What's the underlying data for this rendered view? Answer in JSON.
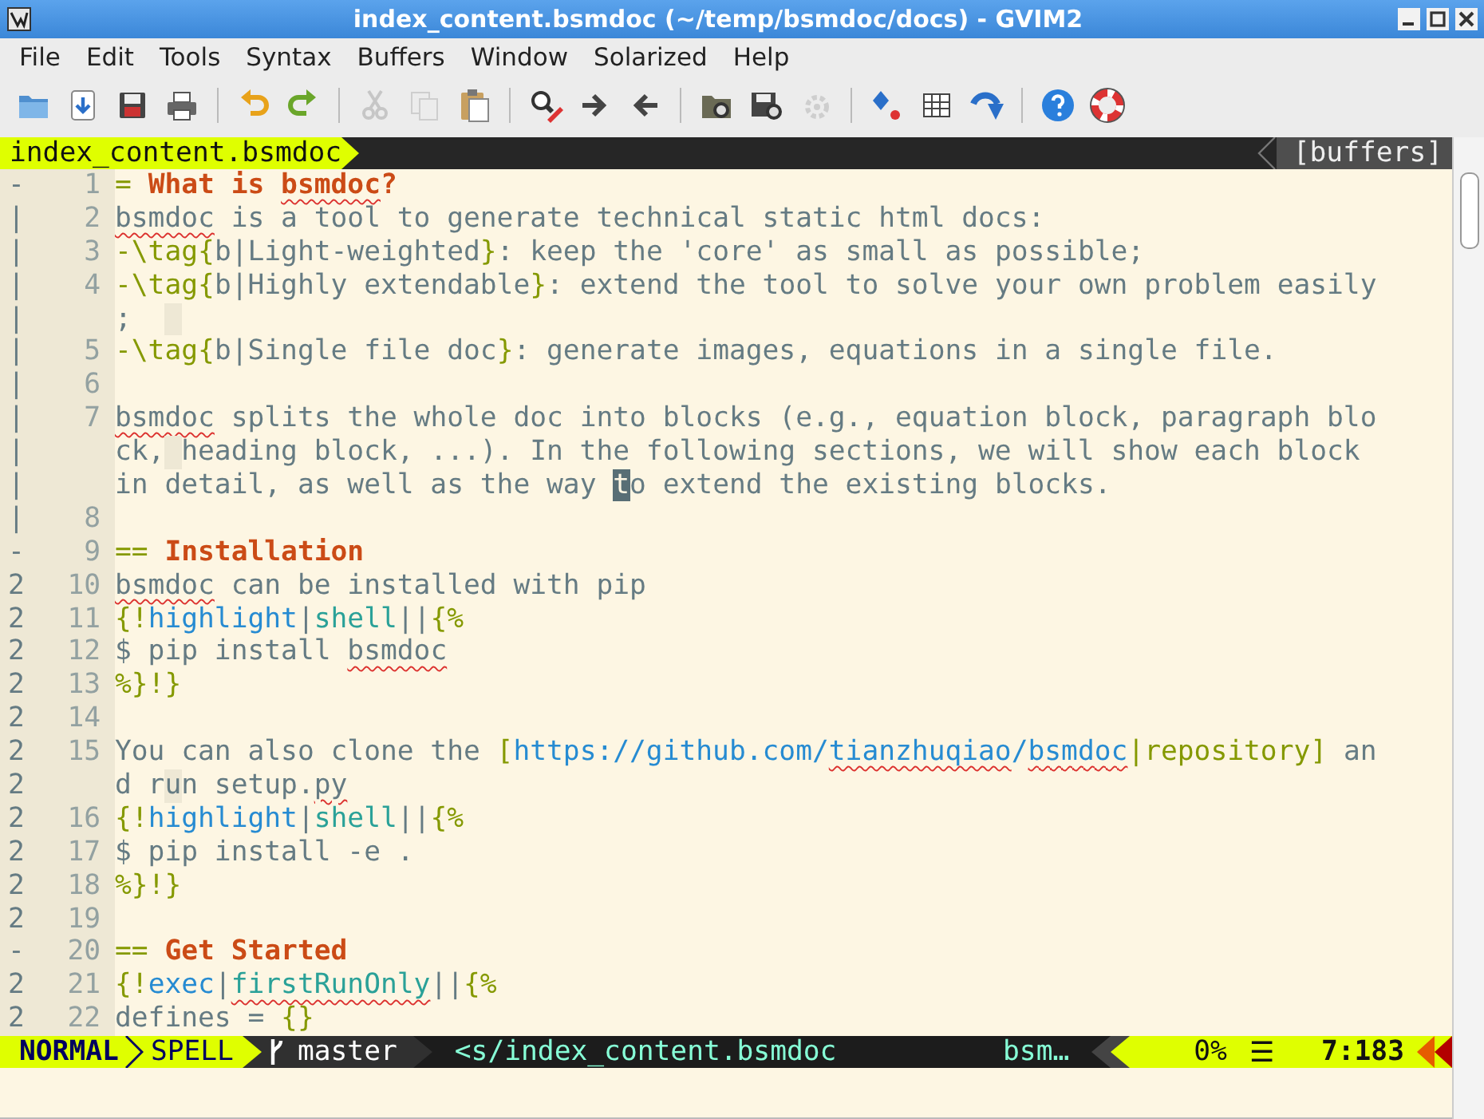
{
  "window": {
    "title": "index_content.bsmdoc (~/temp/bsmdoc/docs) - GVIM2"
  },
  "menu": [
    "File",
    "Edit",
    "Tools",
    "Syntax",
    "Buffers",
    "Window",
    "Solarized",
    "Help"
  ],
  "toolbar": [
    [
      {
        "disabled": false
      },
      {
        "disabled": false
      },
      {
        "disabled": false
      },
      {
        "disabled": false
      }
    ],
    [
      {
        "disabled": false
      },
      {
        "disabled": false
      }
    ],
    [
      {
        "disabled": true
      },
      {
        "disabled": true
      },
      {
        "disabled": false
      }
    ],
    [
      {
        "disabled": false
      },
      {
        "disabled": false
      },
      {
        "disabled": false
      }
    ],
    [
      {
        "disabled": false
      },
      {
        "disabled": false
      },
      {
        "disabled": true
      }
    ],
    [
      {
        "disabled": false
      },
      {
        "disabled": false
      },
      {
        "disabled": false
      }
    ],
    [
      {
        "disabled": false
      },
      {
        "disabled": false
      }
    ]
  ],
  "tabline": {
    "current": "index_content.bsmdoc",
    "right": "[buffers]"
  },
  "rows": [
    {
      "fold": "-",
      "number": "1",
      "segments": [
        {
          "kind": "markup",
          "text": "= ",
          "misspelled": false
        },
        {
          "kind": "heading",
          "text": "What is ",
          "misspelled": false
        },
        {
          "kind": "heading",
          "text": "bsmdoc",
          "misspelled": true
        },
        {
          "kind": "heading",
          "text": "?",
          "misspelled": false
        }
      ]
    },
    {
      "fold": "|",
      "number": "2",
      "segments": [
        {
          "kind": "text",
          "text": "bsmdoc",
          "misspelled": true
        },
        {
          "kind": "text",
          "text": " is a tool to generate technical static html docs:",
          "misspelled": false
        }
      ]
    },
    {
      "fold": "|",
      "number": "3",
      "segments": [
        {
          "kind": "markup",
          "text": "-\\tag{",
          "misspelled": false
        },
        {
          "kind": "text",
          "text": "b|Light-weighted",
          "misspelled": false
        },
        {
          "kind": "markup",
          "text": "}",
          "misspelled": false
        },
        {
          "kind": "text",
          "text": ": keep the 'core' as small as possible;",
          "misspelled": false
        }
      ]
    },
    {
      "fold": "|",
      "number": "4",
      "segments": [
        {
          "kind": "markup",
          "text": "-\\tag{",
          "misspelled": false
        },
        {
          "kind": "text",
          "text": "b|Highly extendable",
          "misspelled": false
        },
        {
          "kind": "markup",
          "text": "}",
          "misspelled": false
        },
        {
          "kind": "text",
          "text": ": extend the tool to solve your own problem easily",
          "misspelled": false
        }
      ]
    },
    {
      "fold": "|",
      "segments": [
        {
          "kind": "text",
          "text": ";",
          "misspelled": false
        },
        {
          "kind": "shade",
          "misspelled": false
        }
      ]
    },
    {
      "fold": "|",
      "number": "5",
      "segments": [
        {
          "kind": "markup",
          "text": "-\\tag{",
          "misspelled": false
        },
        {
          "kind": "text",
          "text": "b|Single file doc",
          "misspelled": false
        },
        {
          "kind": "markup",
          "text": "}",
          "misspelled": false
        },
        {
          "kind": "text",
          "text": ": generate images, equations in a single file.",
          "misspelled": false
        }
      ]
    },
    {
      "fold": "|",
      "number": "6",
      "segments": []
    },
    {
      "fold": "|",
      "number": "7",
      "segments": [
        {
          "kind": "text",
          "text": "bsmdoc",
          "misspelled": true
        },
        {
          "kind": "text",
          "text": " splits the whole doc into blocks (e.g., equation block, paragraph blo",
          "misspelled": false
        }
      ]
    },
    {
      "fold": "|",
      "segments": [
        {
          "kind": "text",
          "text": "ck,",
          "misspelled": false
        },
        {
          "kind": "shade",
          "misspelled": false
        },
        {
          "kind": "text",
          "text": "heading block, ...). In the following sections, we will show each block",
          "misspelled": false
        }
      ]
    },
    {
      "fold": "|",
      "segments": [
        {
          "kind": "text",
          "text": "in detail, as well as the way ",
          "misspelled": false
        },
        {
          "kind": "cursor",
          "text": "t",
          "misspelled": false
        },
        {
          "kind": "text",
          "text": "o extend the existing blocks.",
          "misspelled": false
        }
      ]
    },
    {
      "fold": "|",
      "number": "8",
      "segments": []
    },
    {
      "fold": "-",
      "number": "9",
      "segments": [
        {
          "kind": "markup",
          "text": "== ",
          "misspelled": false
        },
        {
          "kind": "heading",
          "text": "Installation",
          "misspelled": false
        }
      ]
    },
    {
      "fold": "2",
      "number": "10",
      "segments": [
        {
          "kind": "text",
          "text": "bsmdoc",
          "misspelled": true
        },
        {
          "kind": "text",
          "text": " can be installed with pip",
          "misspelled": false
        }
      ]
    },
    {
      "fold": "2",
      "number": "11",
      "segments": [
        {
          "kind": "markup",
          "text": "{!",
          "misspelled": false
        },
        {
          "kind": "keyword",
          "text": "highlight",
          "misspelled": false
        },
        {
          "kind": "text",
          "text": "|",
          "misspelled": false
        },
        {
          "kind": "name",
          "text": "shell",
          "misspelled": false
        },
        {
          "kind": "text",
          "text": "||",
          "misspelled": false
        },
        {
          "kind": "markup",
          "text": "{%",
          "misspelled": false
        }
      ]
    },
    {
      "fold": "2",
      "number": "12",
      "segments": [
        {
          "kind": "text",
          "text": "$ pip install ",
          "misspelled": false
        },
        {
          "kind": "text",
          "text": "bsmdoc",
          "misspelled": true
        }
      ]
    },
    {
      "fold": "2",
      "number": "13",
      "segments": [
        {
          "kind": "markup",
          "text": "%}!}",
          "misspelled": false
        }
      ]
    },
    {
      "fold": "2",
      "number": "14",
      "segments": []
    },
    {
      "fold": "2",
      "number": "15",
      "segments": [
        {
          "kind": "text",
          "text": "You can also clone the ",
          "misspelled": false
        },
        {
          "kind": "markup",
          "text": "[",
          "misspelled": false
        },
        {
          "kind": "keyword",
          "text": "https://github.com/",
          "misspelled": false
        },
        {
          "kind": "keyword",
          "text": "tianzhuqiao",
          "misspelled": true
        },
        {
          "kind": "keyword",
          "text": "/",
          "misspelled": false
        },
        {
          "kind": "keyword",
          "text": "bsmdoc",
          "misspelled": true
        },
        {
          "kind": "markup",
          "text": "|repository]",
          "misspelled": false
        },
        {
          "kind": "text",
          "text": " an",
          "misspelled": false
        }
      ]
    },
    {
      "fold": "2",
      "segments": [
        {
          "kind": "text",
          "text": "d r",
          "misspelled": false
        },
        {
          "kind": "shade",
          "text": "u",
          "misspelled": false
        },
        {
          "kind": "text",
          "text": "n setup.",
          "misspelled": false
        },
        {
          "kind": "text",
          "text": "py",
          "misspelled": true
        }
      ]
    },
    {
      "fold": "2",
      "number": "16",
      "segments": [
        {
          "kind": "markup",
          "text": "{!",
          "misspelled": false
        },
        {
          "kind": "keyword",
          "text": "highlight",
          "misspelled": false
        },
        {
          "kind": "text",
          "text": "|",
          "misspelled": false
        },
        {
          "kind": "name",
          "text": "shell",
          "misspelled": false
        },
        {
          "kind": "text",
          "text": "||",
          "misspelled": false
        },
        {
          "kind": "markup",
          "text": "{%",
          "misspelled": false
        }
      ]
    },
    {
      "fold": "2",
      "number": "17",
      "segments": [
        {
          "kind": "text",
          "text": "$ pip install -e .",
          "misspelled": false
        }
      ]
    },
    {
      "fold": "2",
      "number": "18",
      "segments": [
        {
          "kind": "markup",
          "text": "%}!}",
          "misspelled": false
        }
      ]
    },
    {
      "fold": "2",
      "number": "19",
      "segments": []
    },
    {
      "fold": "-",
      "number": "20",
      "segments": [
        {
          "kind": "markup",
          "text": "== ",
          "misspelled": false
        },
        {
          "kind": "heading",
          "text": "Get Started",
          "misspelled": false
        }
      ]
    },
    {
      "fold": "2",
      "number": "21",
      "segments": [
        {
          "kind": "markup",
          "text": "{!",
          "misspelled": false
        },
        {
          "kind": "keyword",
          "text": "exec",
          "misspelled": false
        },
        {
          "kind": "text",
          "text": "|",
          "misspelled": false
        },
        {
          "kind": "name",
          "text": "firstRunOnly",
          "misspelled": true
        },
        {
          "kind": "text",
          "text": "||",
          "misspelled": false
        },
        {
          "kind": "markup",
          "text": "{%",
          "misspelled": false
        }
      ]
    },
    {
      "fold": "2",
      "number": "22",
      "segments": [
        {
          "kind": "text",
          "text": "defines = ",
          "misspelled": false
        },
        {
          "kind": "markup",
          "text": "{}",
          "misspelled": false
        }
      ]
    }
  ],
  "status_bar": {
    "mode": "NORMAL",
    "spell": "SPELL",
    "branch": "master",
    "file": "<s/index_content.bsmdoc",
    "filetype": "bsm…",
    "percent": "0%",
    "menu_glyph": "☰",
    "position": "7:183"
  }
}
